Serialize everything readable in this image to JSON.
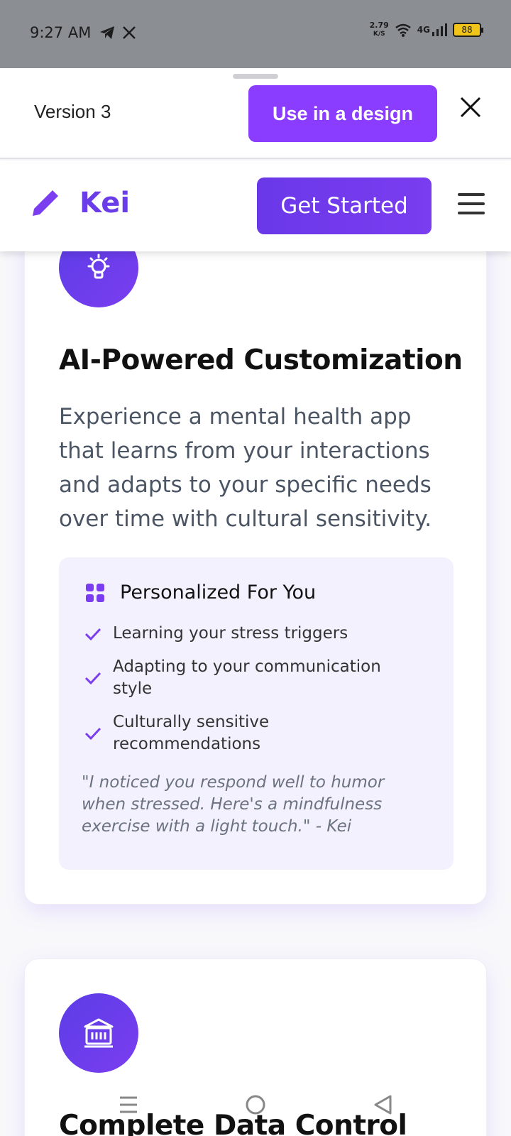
{
  "status_bar": {
    "time": "9:27 AM",
    "net_speed_value": "2.79",
    "net_speed_unit": "K/S",
    "network_type": "4G",
    "battery": "88",
    "icons": [
      "telegram-icon",
      "x-icon",
      "wifi-icon",
      "signal-icon",
      "battery-icon"
    ]
  },
  "sheet": {
    "version_label": "Version 3",
    "use_button": "Use in a design",
    "close_icon": "close-icon"
  },
  "site_nav": {
    "brand": "Kei",
    "cta": "Get Started",
    "menu_icon": "hamburger-icon"
  },
  "card1": {
    "icon": "lightbulb-icon",
    "title": "AI-Powered Customization",
    "description": "Experience a mental health app that learns from your interactions and adapts to your specific needs over time with cultural sensitivity.",
    "feature_box": {
      "icon": "grid-icon",
      "title": "Personalized For You",
      "items": [
        "Learning your stress triggers",
        "Adapting to your communication style",
        "Culturally sensitive recommendations"
      ],
      "quote": "\"I noticed you respond well to humor when stressed. Here's a mindfulness exercise with a light touch.\" - Kei"
    }
  },
  "card2": {
    "icon": "bank-icon",
    "title": "Complete Data Control"
  },
  "colors": {
    "accent": "#8b3dff",
    "brand": "#6a3de8",
    "feature_bg": "#f4f1fe"
  }
}
